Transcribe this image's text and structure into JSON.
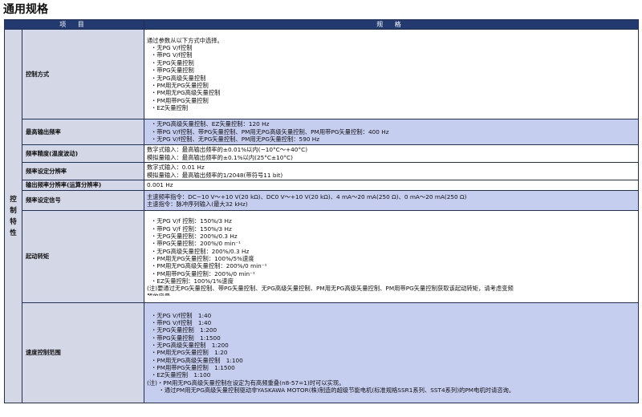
{
  "page_title": "通用规格",
  "table": {
    "header_item": "项 目",
    "header_spec": "规 格",
    "group_label": [
      "控",
      "制",
      "特",
      "性"
    ],
    "rows": [
      {
        "item": "控制方式",
        "highlight": false,
        "lines": [
          "通过参数从以下方式中选择。",
          "・无PG V/f控制",
          "・带PG V/f控制",
          "・无PG矢量控制",
          "・带PG矢量控制",
          "・无PG高级矢量控制",
          "・PM用无PG矢量控制",
          "・PM用无PG高级矢量控制",
          "・PM用带PG矢量控制",
          "・EZ矢量控制"
        ]
      },
      {
        "item": "最高输出频率",
        "highlight": true,
        "lines": [
          "・无PG高级矢量控制、EZ矢量控制：120 Hz",
          "・带PG V/f控制、带PG矢量控制、PM用无PG高级矢量控制、PM用带PG矢量控制：400 Hz",
          "・无PG V/f控制、无PG矢量控制、PM用无PG矢量控制：590 Hz"
        ]
      },
      {
        "item": "频率精度(温度波动)",
        "highlight": false,
        "lines": [
          "数字式输入：最高输出频率的±0.01%以内(−10°C～+40°C)",
          "模拟量输入：最高输出频率的±0.1%以内(25°C±10°C)"
        ]
      },
      {
        "item": "频率设定分辨率",
        "highlight": false,
        "lines": [
          "数字式输入：0.01 Hz",
          "模拟量输入：最高输出频率的1/2048(带符号11 bit)"
        ]
      },
      {
        "item": "输出频率分辨率(运算分辨率)",
        "highlight": false,
        "lines": [
          "0.001 Hz"
        ]
      },
      {
        "item": "频率设定信号",
        "highlight": true,
        "lines": [
          "主速频率指令：DC−10 V～+10 V(20 kΩ)、DC0 V～+10 V(20 kΩ)、4 mA～20 mA(250 Ω)、0 mA～20 mA(250 Ω)",
          "主速指令：脉冲序列输入(最大32 kHz)"
        ]
      },
      {
        "item": "起动转矩",
        "highlight": false,
        "lines": [
          "・无PG V/f 控制：150%/3 Hz",
          "・带PG V/f 控制：150%/3 Hz",
          "・无PG矢量控制：200%/0.3 Hz",
          "・带PG矢量控制：200%/0 min⁻¹",
          "・无PG高级矢量控制：200%/0.3 Hz",
          "・PM用无PG矢量控制：100%/5%速度",
          "・PM用无PG高级矢量控制：200%/0 min⁻¹",
          "・PM用带PG矢量控制：200%/0 min⁻¹",
          "・EZ矢量控制：100%/1%速度",
          "(注)要通过无PG矢量控制、带PG矢量控制、无PG高级矢量控制、PM用无PG高级矢量控制、PM用带PG矢量控制获取该起动转矩，请考虑变频",
          "器的容量。"
        ]
      },
      {
        "item": "速度控制范围",
        "highlight": true,
        "lines": [
          "・无PG V/f控制　1:40",
          "・带PG V/f控制　1:40",
          "・无PG矢量控制　1:200",
          "・带PG矢量控制　1:1500",
          "・无PG高级矢量控制　1:200",
          "・PM用无PG矢量控制　1:20",
          "・PM用无PG高级矢量控制　1:100",
          "・PM用带PG矢量控制　1:1500",
          "・EZ矢量控制　1:100",
          "(注)・PM用无PG高级矢量控制在设定为有高频重叠(n8-57=1)时可以实现。",
          "　　・通过PM用无PG高级矢量控制驱动非YASKAWA MOTOR(株)制造的超级节能电机(标准规格SSR1系列、SST4系列)的PM电机时请咨询。"
        ]
      }
    ]
  }
}
